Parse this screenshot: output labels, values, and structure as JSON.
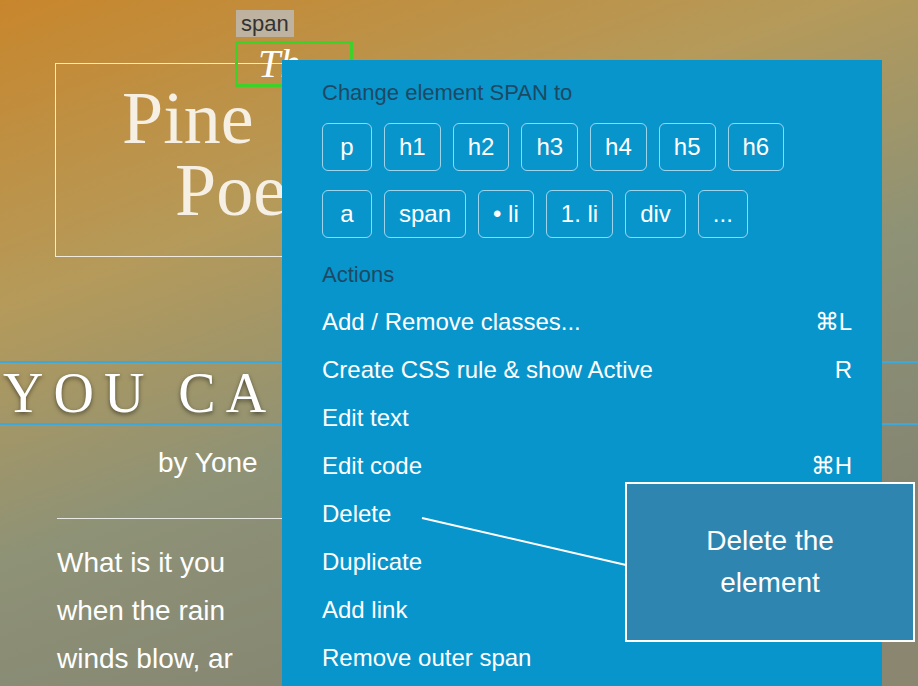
{
  "page": {
    "tag_label": "span",
    "selected_text": "Th",
    "title_lines": [
      "Pine",
      "Poe"
    ],
    "banner": "YOU CA",
    "byline": "by Yone",
    "paragraph_lines": [
      "What is it you",
      "when the rain",
      "winds blow, ar"
    ]
  },
  "context_menu": {
    "header": "Change element SPAN to",
    "element_types": [
      [
        "p",
        "h1",
        "h2",
        "h3",
        "h4",
        "h5",
        "h6"
      ],
      [
        "a",
        "span",
        "• li",
        "1. li",
        "div",
        "..."
      ]
    ],
    "actions_label": "Actions",
    "actions": [
      {
        "label": "Add / Remove classes...",
        "shortcut": "⌘L",
        "pointed": false
      },
      {
        "label": "Create CSS rule & show Active",
        "shortcut": "R",
        "pointed": false
      },
      {
        "label": "Edit text",
        "shortcut": "",
        "pointed": false
      },
      {
        "label": "Edit code",
        "shortcut": "⌘H",
        "pointed": false
      },
      {
        "label": "Delete",
        "shortcut": "",
        "pointed": true
      },
      {
        "label": "Duplicate",
        "shortcut": "",
        "pointed": false
      },
      {
        "label": "Add link",
        "shortcut": "",
        "pointed": false
      },
      {
        "label": "Remove outer span",
        "shortcut": "",
        "pointed": false
      }
    ]
  },
  "callout": {
    "text": "Delete the element"
  }
}
